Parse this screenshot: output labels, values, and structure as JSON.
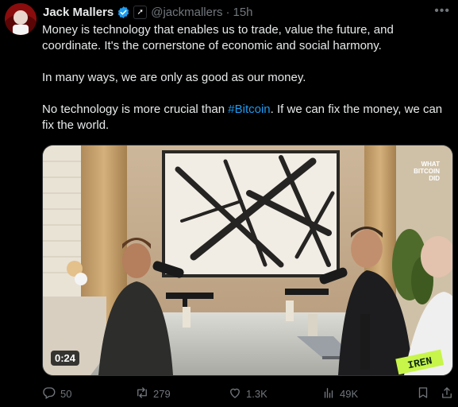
{
  "tweet": {
    "author_name": "Jack Mallers",
    "handle": "@jackmallers",
    "separator": "·",
    "time": "15h",
    "paragraphs": {
      "p1": "Money is technology that enables us to trade, value the future, and coordinate. It's the cornerstone of economic and social harmony.",
      "p2": "In many ways, we are only as good as our money.",
      "p3_before": "No technology is more crucial than ",
      "p3_hashtag": "#Bitcoin",
      "p3_after": ". If we can fix the money, we can fix the world."
    }
  },
  "media": {
    "duration": "0:24",
    "watermark_line1": "WHAT",
    "watermark_line2": "BITCOIN",
    "watermark_line3": "DID",
    "sponsor_logo": "IREN"
  },
  "actions": {
    "replies": "50",
    "reposts": "279",
    "likes": "1.3K",
    "views": "49K"
  },
  "colors": {
    "accent": "#1d9bf0",
    "muted": "#71767b",
    "background": "#000000"
  },
  "icons": [
    "verified-badge-icon",
    "affiliate-icon",
    "more-icon",
    "reply-icon",
    "repost-icon",
    "like-icon",
    "views-icon",
    "bookmark-icon",
    "share-icon"
  ]
}
